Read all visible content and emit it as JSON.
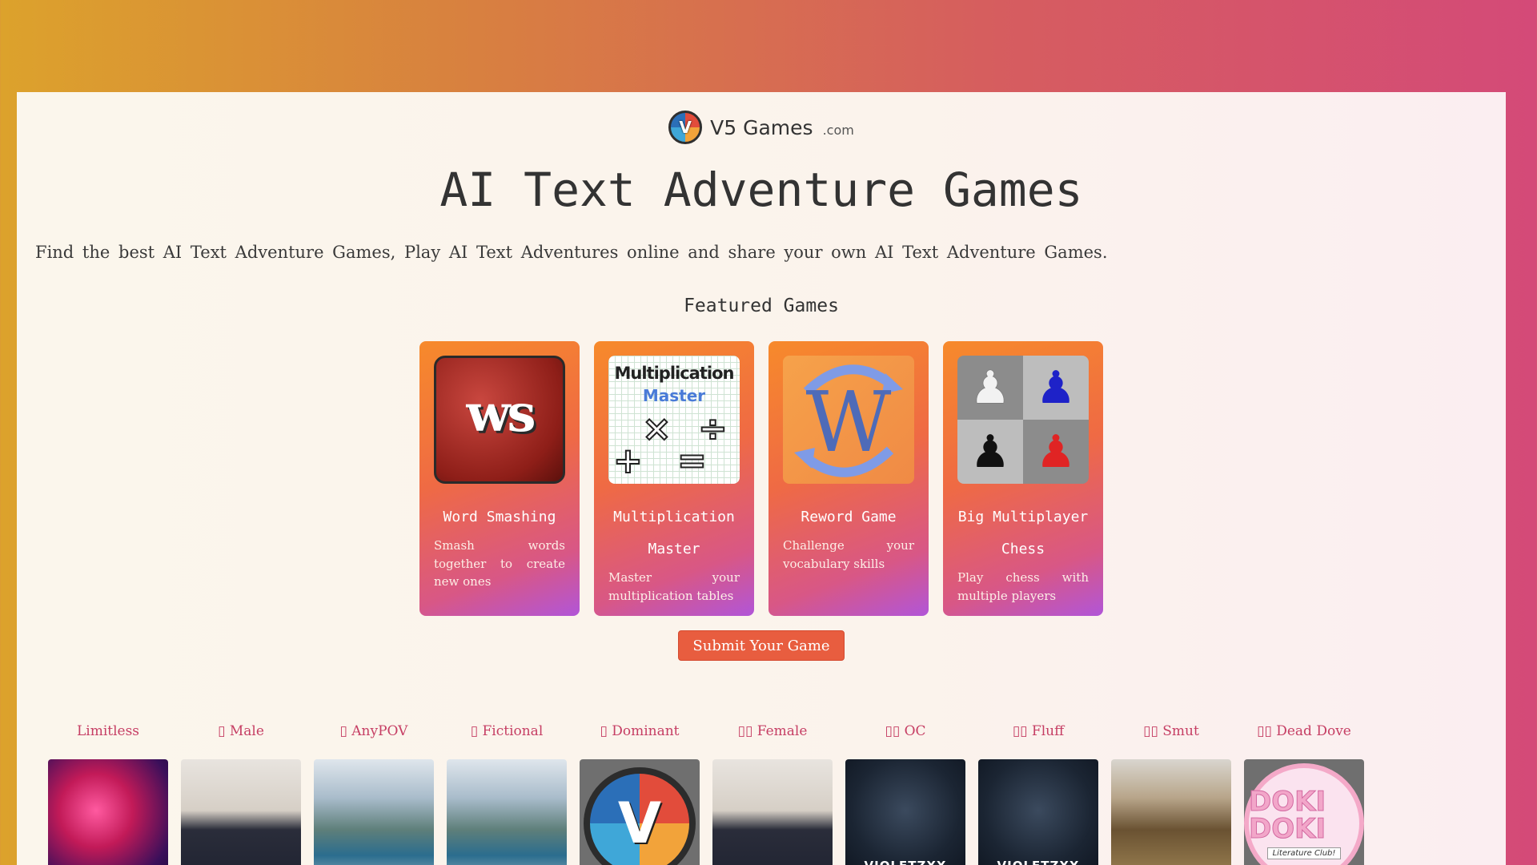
{
  "header": {
    "brand_name": "V5 Games",
    "brand_tld": ".com",
    "logo_letter": "V"
  },
  "page": {
    "title": "AI Text Adventure Games",
    "tagline": "Find the best AI Text Adventure Games, Play AI Text Adventures online and share your own AI Text Adventure Games."
  },
  "featured": {
    "heading": "Featured Games",
    "cards": [
      {
        "title": "Word Smashing",
        "description": "Smash words together to create new ones",
        "image_text": "ws"
      },
      {
        "title": "Multiplication Master",
        "description": "Master your multiplication tables",
        "image_line1": "Multiplication",
        "image_line2": "Master"
      },
      {
        "title": "Reword Game",
        "description": "Challenge your vocabulary skills",
        "image_text": "W"
      },
      {
        "title": "Big Multiplayer Chess",
        "description": "Play chess with multiple players"
      }
    ],
    "submit_label": "Submit Your Game"
  },
  "tags": [
    {
      "label": "Limitless",
      "image": "space-nebula"
    },
    {
      "label": "▯ Male",
      "image": "suited-characters"
    },
    {
      "label": "▯ AnyPOV",
      "image": "landscape"
    },
    {
      "label": "▯ Fictional",
      "image": "landscape"
    },
    {
      "label": "▯ Dominant",
      "image": "v5-logo"
    },
    {
      "label": "▯▯ Female",
      "image": "suited-characters"
    },
    {
      "label": "▯▯ OC",
      "image": "dark-character",
      "image_text": "VIOLETZXX"
    },
    {
      "label": "▯▯ Fluff",
      "image": "dark-character",
      "image_text": "VIOLETZXX"
    },
    {
      "label": "▯▯ Smut",
      "image": "golden-mask"
    },
    {
      "label": "▯▯ Dead Dove",
      "image": "doki-doki",
      "image_text": "DOKI DOKI",
      "image_subtext": "Literature Club!"
    }
  ],
  "colors": {
    "accent": "#e85d3f",
    "tag_text": "#c63e64",
    "card_gradient_start": "#f78a2b",
    "card_gradient_end": "#b155d8"
  }
}
